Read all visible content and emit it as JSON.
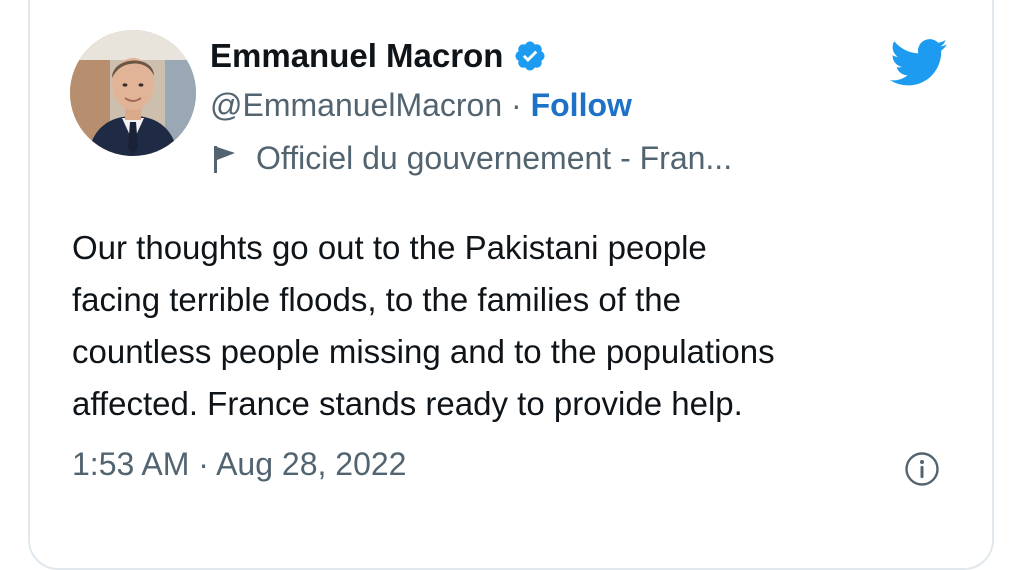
{
  "author": {
    "name": "Emmanuel Macron",
    "handle": "@EmmanuelMacron",
    "separator": " · ",
    "follow_label": "Follow",
    "account_label": "Officiel du gouvernement - Fran..."
  },
  "tweet": {
    "text": "Our thoughts go out to the Pakistani people\nfacing terrible floods, to the families of the\ncountless people missing and to the populations\naffected. France stands ready to provide help.",
    "timestamp": "1:53 AM · Aug 28, 2022"
  },
  "icons": {
    "verified": "verified-badge-icon",
    "brand": "twitter-bird-icon",
    "flag": "flag-icon",
    "info": "info-icon"
  },
  "colors": {
    "accent": "#1d9bf0",
    "follow": "#1d72c8",
    "text": "#0f1419",
    "secondary": "#536471",
    "border": "#e1e8ed"
  }
}
